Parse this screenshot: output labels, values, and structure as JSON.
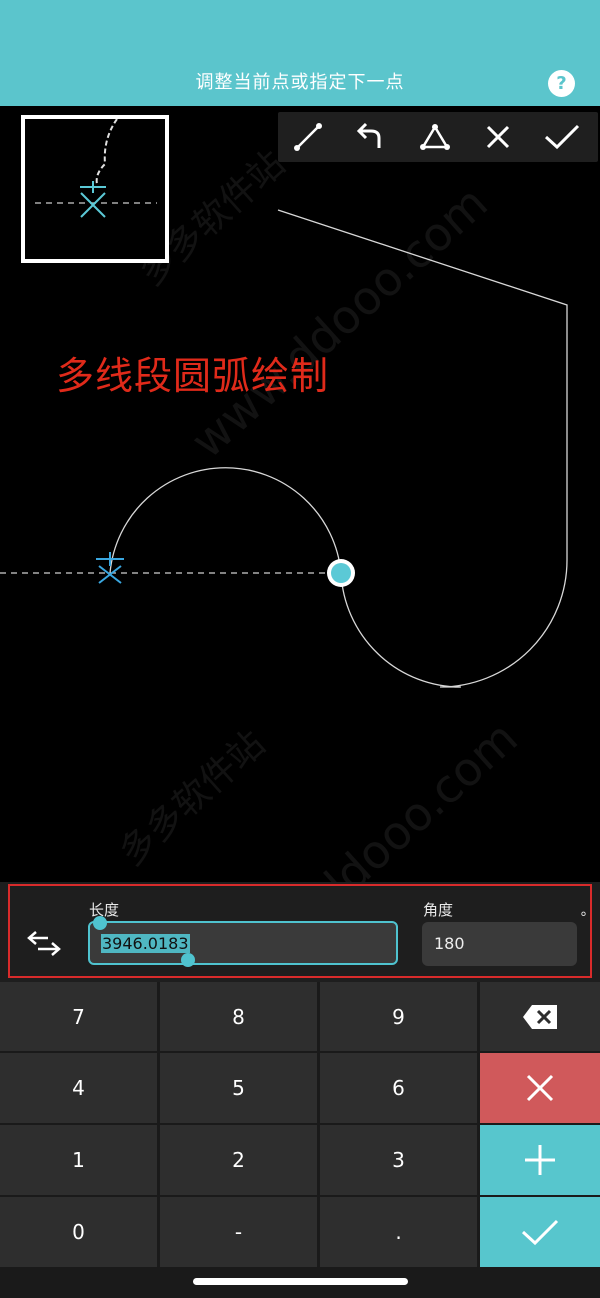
{
  "header": {
    "title": "调整当前点或指定下一点",
    "help_label": "?"
  },
  "toolbar": {
    "icons": [
      "line-icon",
      "undo-icon",
      "triangle-icon",
      "close-icon",
      "check-icon"
    ]
  },
  "canvas": {
    "caption": "多线段圆弧绘制"
  },
  "watermark": {
    "text_a": "多多软件站",
    "text_b": "www.ddooo.com"
  },
  "input": {
    "length_label": "长度",
    "length_value": "3946.0183",
    "angle_label": "角度",
    "angle_value": "180",
    "degree_symbol": "°"
  },
  "keypad": {
    "keys": [
      "7",
      "8",
      "9",
      "4",
      "5",
      "6",
      "1",
      "2",
      "3",
      "0",
      "-",
      "."
    ],
    "colors": {
      "delete": "#d0595b",
      "confirm": "#57c6cd",
      "key": "#2e2e2e"
    }
  }
}
